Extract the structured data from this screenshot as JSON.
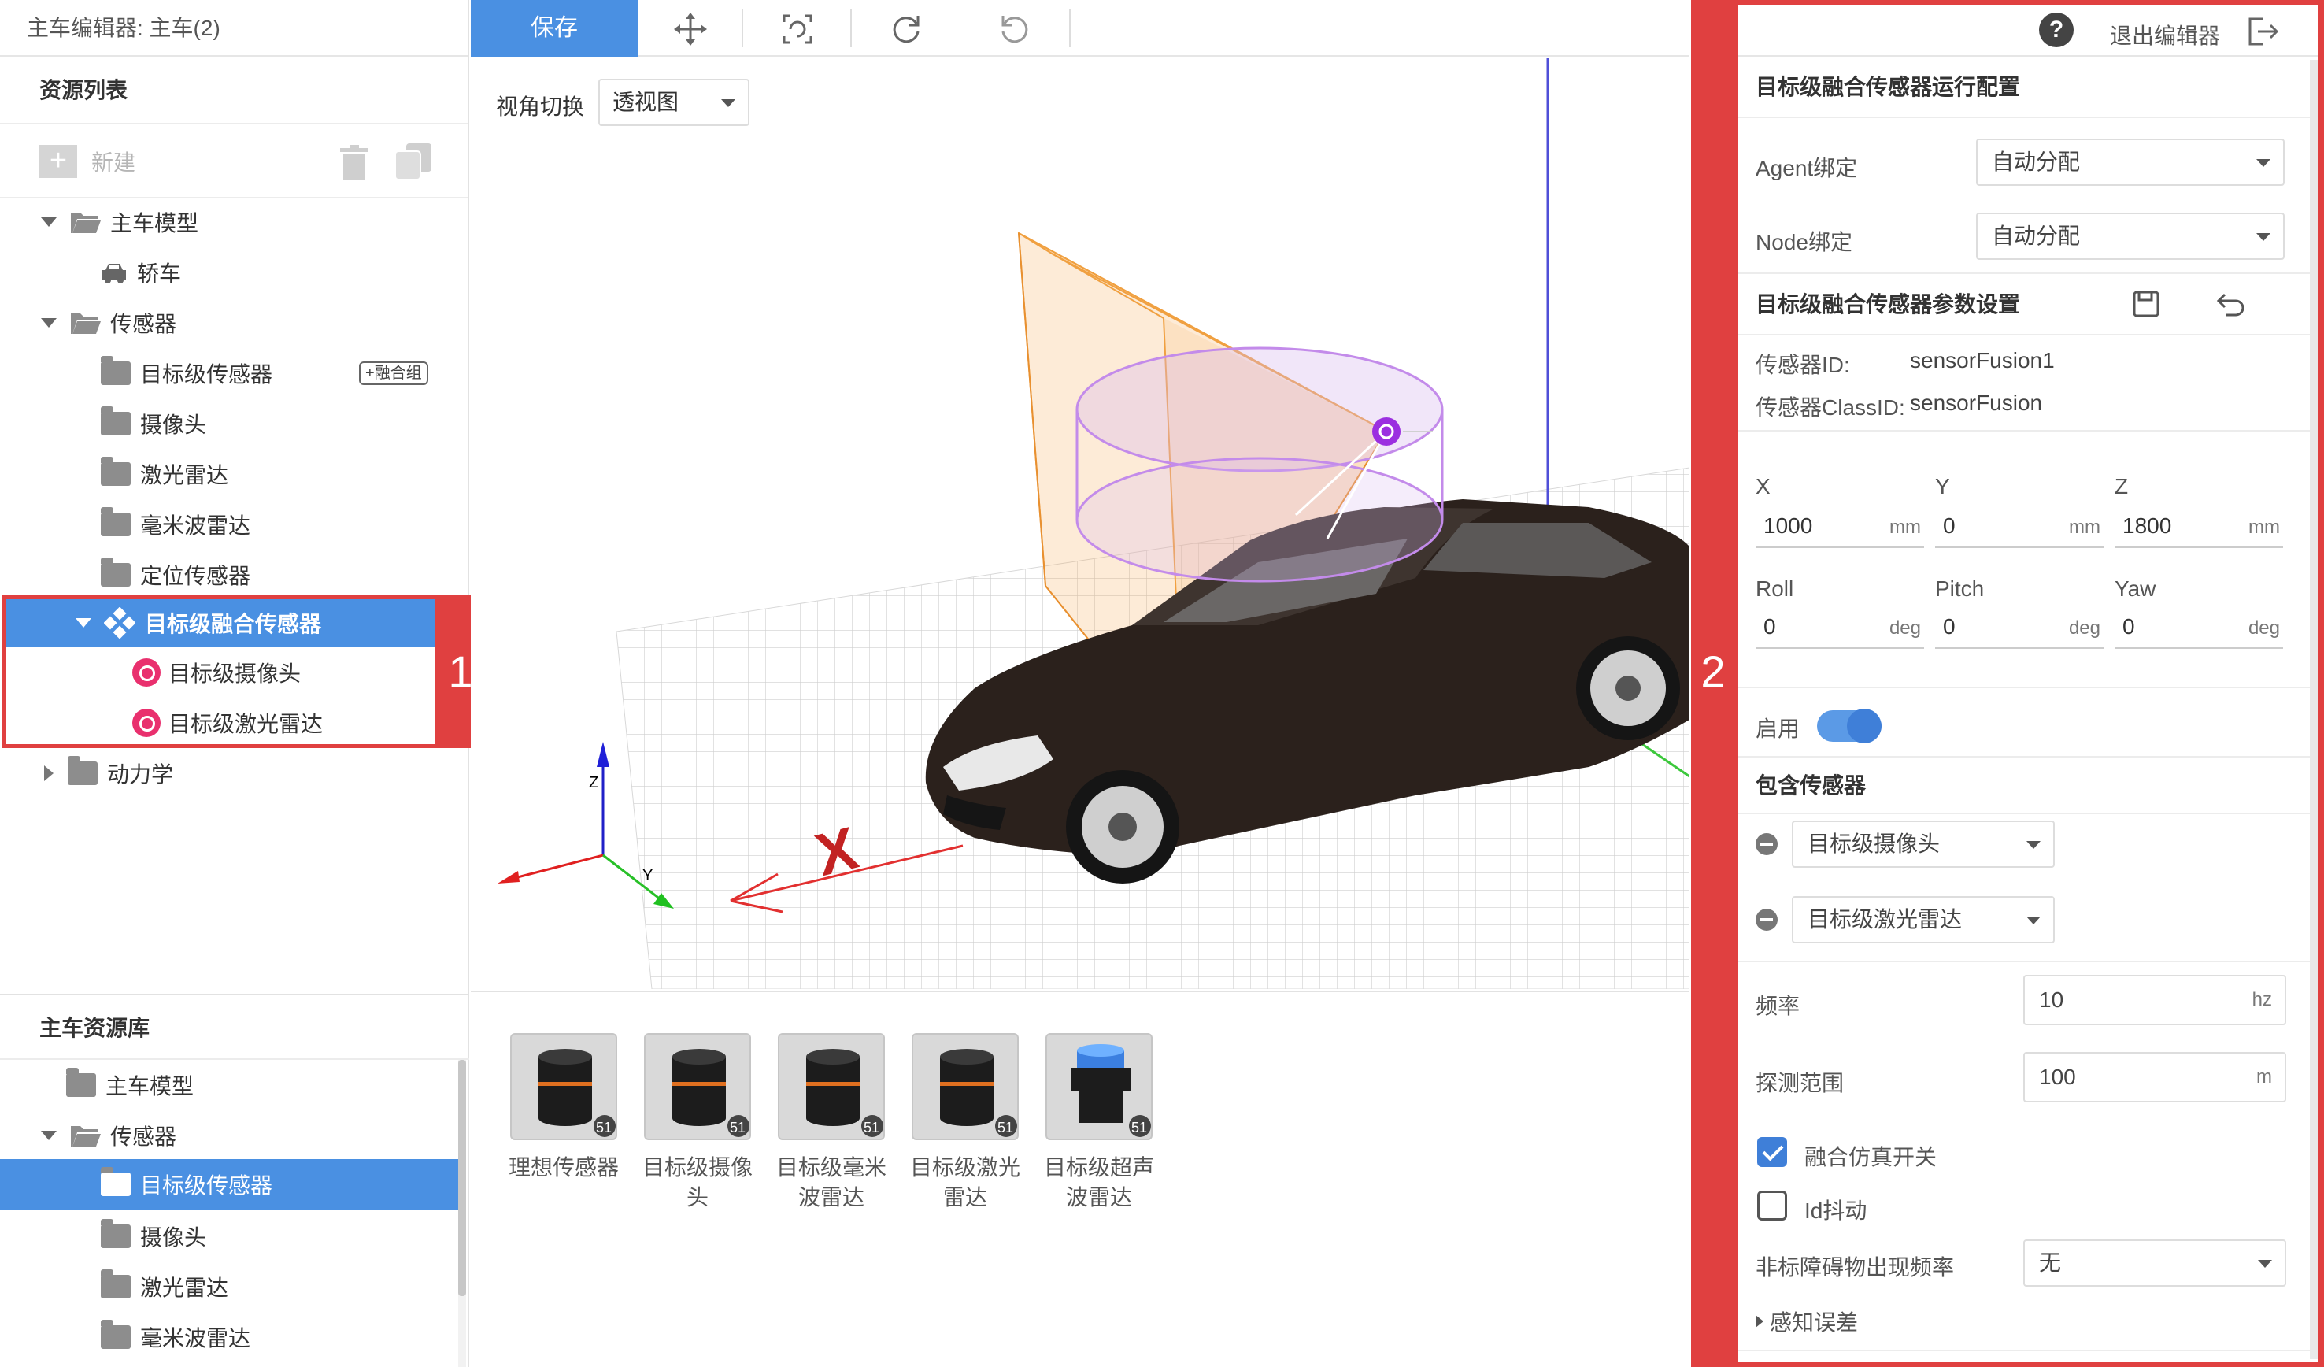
{
  "window": {
    "title": "主车编辑器: 主车(2)"
  },
  "left": {
    "resource_title": "资源列表",
    "new_label": "新建",
    "tree": [
      {
        "label": "主车模型",
        "icon": "folder-open-icon"
      },
      {
        "label": "轿车",
        "icon": "car-icon"
      },
      {
        "label": "传感器",
        "icon": "folder-open-icon"
      },
      {
        "label": "目标级传感器",
        "icon": "folder-icon",
        "tag": "+融合组"
      },
      {
        "label": "摄像头",
        "icon": "folder-icon"
      },
      {
        "label": "激光雷达",
        "icon": "folder-icon"
      },
      {
        "label": "毫米波雷达",
        "icon": "folder-icon"
      },
      {
        "label": "定位传感器",
        "icon": "folder-icon"
      },
      {
        "label": "目标级融合传感器",
        "icon": "fusion-icon",
        "selected": true
      },
      {
        "label": "目标级摄像头",
        "icon": "sensor-pink-icon"
      },
      {
        "label": "目标级激光雷达",
        "icon": "sensor-pink-icon"
      },
      {
        "label": "动力学",
        "icon": "folder-icon"
      }
    ],
    "annotation": "1",
    "library_title": "主车资源库",
    "library_tree": [
      {
        "label": "主车模型"
      },
      {
        "label": "传感器"
      },
      {
        "label": "目标级传感器",
        "selected": true
      },
      {
        "label": "摄像头"
      },
      {
        "label": "激光雷达"
      },
      {
        "label": "毫米波雷达"
      }
    ]
  },
  "toolbar": {
    "save_label": "保存",
    "icons": [
      "move-icon",
      "reset-view-icon",
      "rotate-cw-icon",
      "rotate-ccw-icon"
    ]
  },
  "viewport": {
    "view_label": "视角切换",
    "view_value": "透视图",
    "axis_labels": {
      "x": "X",
      "y": "Y",
      "z": "Z"
    }
  },
  "library": {
    "items": [
      {
        "label": "理想传感器",
        "badge": "51"
      },
      {
        "label": "目标级摄像头",
        "badge": "51"
      },
      {
        "label": "目标级毫米波雷达",
        "badge": "51"
      },
      {
        "label": "目标级激光雷达",
        "badge": "51"
      },
      {
        "label": "目标级超声波雷达",
        "badge": "51"
      }
    ]
  },
  "right": {
    "annotation": "2",
    "help": "?",
    "exit_label": "退出编辑器",
    "run_config_title": "目标级融合传感器运行配置",
    "agent_label": "Agent绑定",
    "agent_value": "自动分配",
    "node_label": "Node绑定",
    "node_value": "自动分配",
    "params_title": "目标级融合传感器参数设置",
    "sensor_id_label": "传感器ID:",
    "sensor_id_value": "sensorFusion1",
    "sensor_class_label": "传感器ClassID:",
    "sensor_class_value": "sensorFusion",
    "x_label": "X",
    "x_value": "1000",
    "x_unit": "mm",
    "y_label": "Y",
    "y_value": "0",
    "y_unit": "mm",
    "z_label": "Z",
    "z_value": "1800",
    "z_unit": "mm",
    "roll_label": "Roll",
    "roll_value": "0",
    "roll_unit": "deg",
    "pitch_label": "Pitch",
    "pitch_value": "0",
    "pitch_unit": "deg",
    "yaw_label": "Yaw",
    "yaw_value": "0",
    "yaw_unit": "deg",
    "enable_label": "启用",
    "enabled": true,
    "included_title": "包含传感器",
    "included": [
      "目标级摄像头",
      "目标级激光雷达"
    ],
    "freq_label": "频率",
    "freq_value": "10",
    "freq_unit": "hz",
    "range_label": "探测范围",
    "range_value": "100",
    "range_unit": "m",
    "fusion_sim_label": "融合仿真开关",
    "fusion_sim_checked": true,
    "id_jitter_label": "Id抖动",
    "id_jitter_checked": false,
    "nonstd_label": "非标障碍物出现频率",
    "nonstd_value": "无",
    "perception_error_label": "感知误差"
  },
  "colors": {
    "accent": "#4a90e2",
    "annotation": "#e04040",
    "pink": "#e9306e"
  }
}
